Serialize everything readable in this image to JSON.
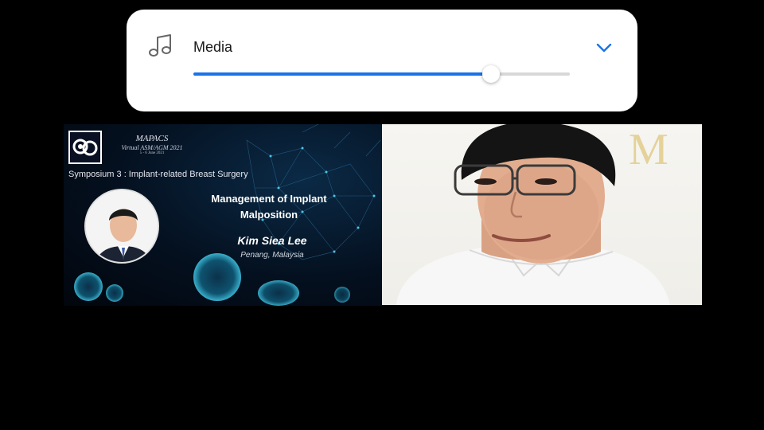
{
  "volume_panel": {
    "icon": "music-note-icon",
    "label": "Media",
    "level": 0.79,
    "expand_icon": "chevron-down-icon",
    "accent_color": "#1a73e8"
  },
  "slide": {
    "conference_title": "MAPACS",
    "conference_subtitle": "Virtual ASM/AGM 2021",
    "conference_dates": "5 - 6 June 2021",
    "symposium": "Symposium 3 : Implant-related Breast Surgery",
    "talk_title_line1": "Management of Implant",
    "talk_title_line2": "Malposition",
    "speaker_name": "Kim Siea Lee",
    "speaker_location": "Penang, Malaysia"
  },
  "video": {
    "watermark": "M"
  }
}
